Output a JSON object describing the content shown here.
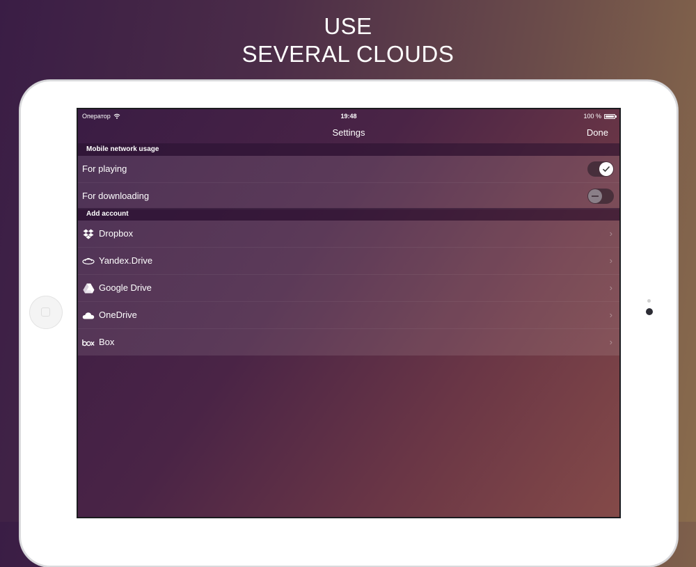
{
  "headline": {
    "line1": "USE",
    "line2": "SEVERAL CLOUDS"
  },
  "statusbar": {
    "carrier": "Оператор",
    "time": "19:48",
    "battery": "100 %"
  },
  "navbar": {
    "title": "Settings",
    "done_label": "Done"
  },
  "mobile_section": {
    "header": "Mobile network usage",
    "rows": [
      {
        "label": "For playing",
        "toggle": "on"
      },
      {
        "label": "For downloading",
        "toggle": "off"
      }
    ]
  },
  "accounts_section": {
    "header": "Add account",
    "items": [
      {
        "label": "Dropbox",
        "icon": "dropbox-icon"
      },
      {
        "label": "Yandex.Drive",
        "icon": "yandex-disk-icon"
      },
      {
        "label": "Google Drive",
        "icon": "google-drive-icon"
      },
      {
        "label": "OneDrive",
        "icon": "onedrive-icon"
      },
      {
        "label": "Box",
        "icon": "box-logo-icon"
      }
    ]
  },
  "colors": {
    "text": "#ffffff",
    "toggle_on_knob": "#ffffff",
    "toggle_off_knob": "#8a7f88"
  }
}
